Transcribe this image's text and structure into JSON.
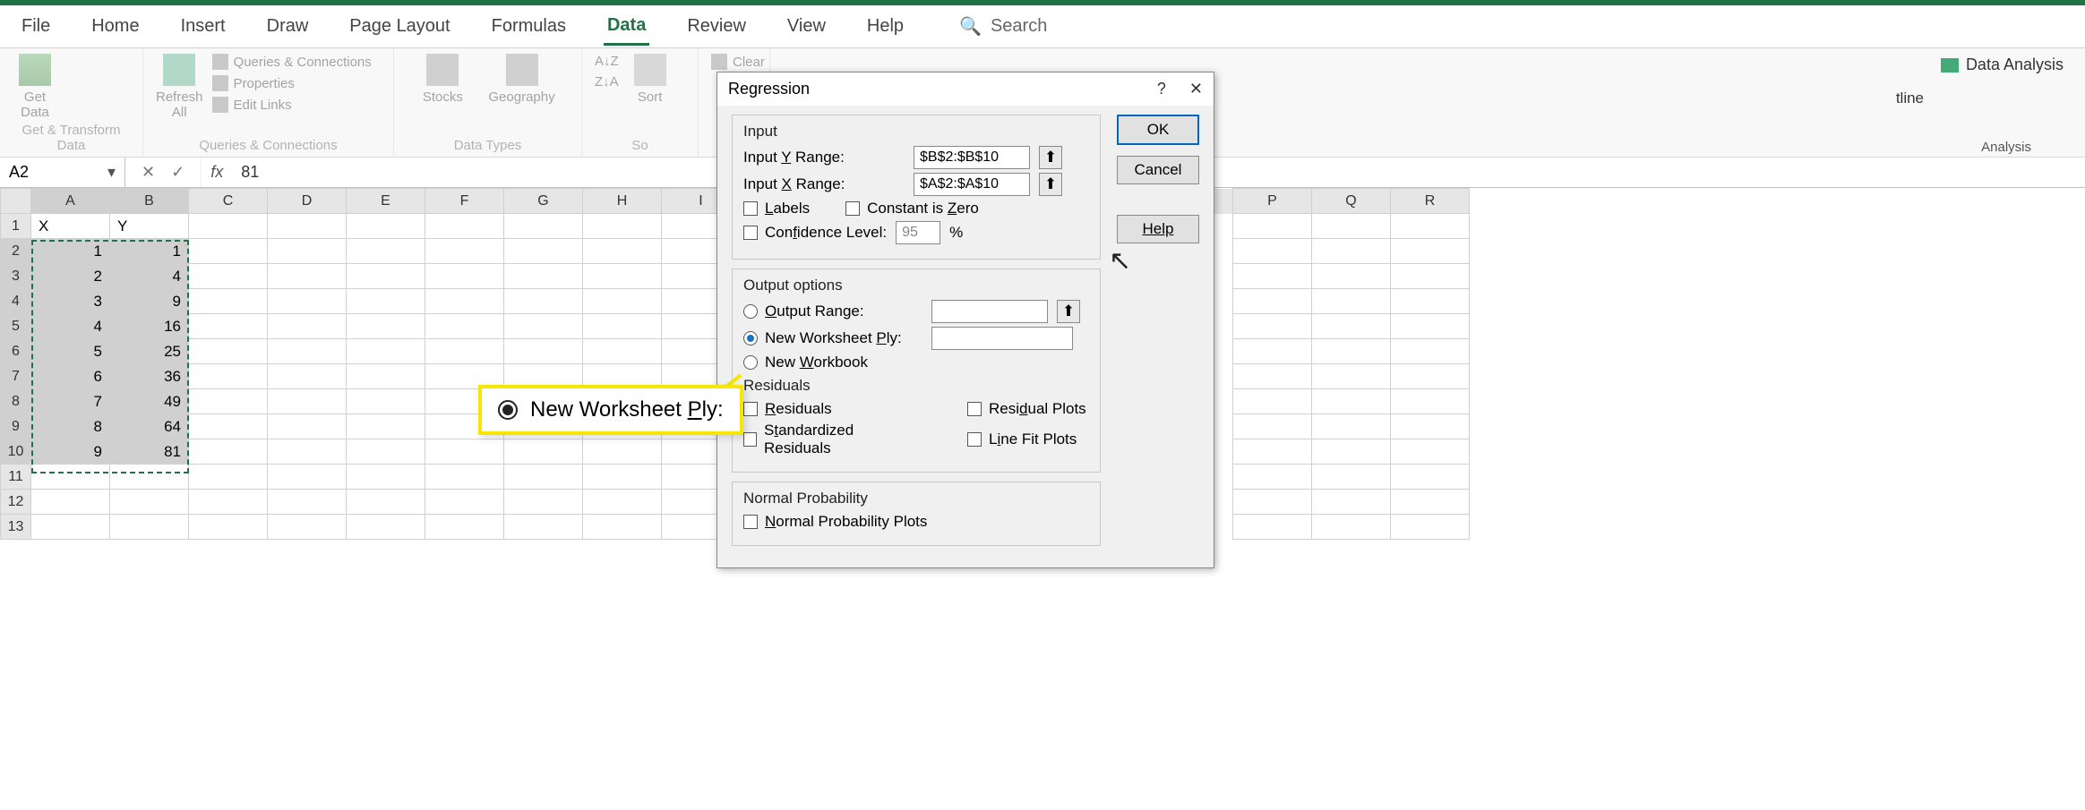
{
  "tabs": [
    "File",
    "Home",
    "Insert",
    "Draw",
    "Page Layout",
    "Formulas",
    "Data",
    "Review",
    "View",
    "Help"
  ],
  "active_tab": "Data",
  "search_placeholder": "Search",
  "ribbon": {
    "get_data": "Get\nData",
    "group1": "Get & Transform Data",
    "refresh": "Refresh\nAll",
    "queries": "Queries & Connections",
    "properties": "Properties",
    "edit_links": "Edit Links",
    "group2": "Queries & Connections",
    "stocks": "Stocks",
    "geography": "Geography",
    "group3": "Data Types",
    "sort": "Sort",
    "group4": "So",
    "clear": "Clear",
    "data_analysis": "Data Analysis",
    "analysis_label": "Analysis",
    "outline": "tline"
  },
  "namebox": "A2",
  "formula": "81",
  "columns": [
    "A",
    "B",
    "C",
    "D",
    "E",
    "F",
    "G",
    "H",
    "I",
    "P",
    "Q",
    "R"
  ],
  "rows": [
    1,
    2,
    3,
    4,
    5,
    6,
    7,
    8,
    9,
    10,
    11,
    12,
    13
  ],
  "headers": {
    "A": "X",
    "B": "Y"
  },
  "data": [
    {
      "A": "1",
      "B": "1"
    },
    {
      "A": "2",
      "B": "4"
    },
    {
      "A": "3",
      "B": "9"
    },
    {
      "A": "4",
      "B": "16"
    },
    {
      "A": "5",
      "B": "25"
    },
    {
      "A": "6",
      "B": "36"
    },
    {
      "A": "7",
      "B": "49"
    },
    {
      "A": "8",
      "B": "64"
    },
    {
      "A": "9",
      "B": "81"
    }
  ],
  "dialog": {
    "title": "Regression",
    "input_label": "Input",
    "input_y": "Input Y Range:",
    "input_y_val": "$B$2:$B$10",
    "input_x": "Input X Range:",
    "input_x_val": "$A$2:$A$10",
    "labels": "Labels",
    "const_zero": "Constant is Zero",
    "conf": "Confidence Level:",
    "conf_val": "95",
    "pct": "%",
    "output_label": "Output options",
    "out_range": "Output Range:",
    "new_ws": "New Worksheet Ply:",
    "new_wb": "New Workbook",
    "resid_label": "Residuals",
    "resid": "Residuals",
    "std_resid": "Standardized Residuals",
    "resid_plot": "Residual Plots",
    "line_fit": "Line Fit Plots",
    "normprob_label": "Normal Probability",
    "normprob": "Normal Probability Plots",
    "ok": "OK",
    "cancel": "Cancel",
    "help": "Help"
  },
  "callout": "New Worksheet Ply:"
}
